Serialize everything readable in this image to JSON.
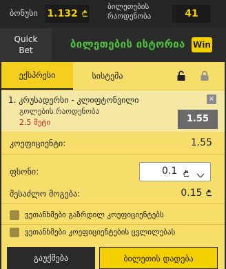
{
  "header": {
    "bonus_label": "ბონუსი",
    "bonus_value": "1.132",
    "tickets_label_line1": "ბილეთების",
    "tickets_label_line2": "რაოდენობა",
    "tickets_value": "41"
  },
  "bar": {
    "quick_line1": "Quick",
    "quick_line2": "Bet",
    "history_title": "ბილეთების ისტორია",
    "win_label": "Win"
  },
  "tabs": [
    {
      "label": "ექსპრესი",
      "active": true
    },
    {
      "label": "სისტემა",
      "active": false
    }
  ],
  "bet": {
    "number": "1.",
    "event": "კრუსადერსი - კლიფტონვილი",
    "market": "გოლების რაოდენობა",
    "selection": "2.5 მეტი",
    "odds": "1.55",
    "close_symbol": "×"
  },
  "summary": {
    "coef_label": "კოეფიციენტი:",
    "coef_value": "1.55",
    "stake_label": "ფსონი:",
    "stake_value": "0.1",
    "payout_label": "შესაძლო მოგება:",
    "payout_value": "0.15"
  },
  "options": [
    {
      "label": "ვეთანხმები გაზრდილ კოეფიციენტებს",
      "checked": false
    },
    {
      "label": "ვეთანხმები კოეფიციენტების ცვლილებას",
      "checked": false
    }
  ],
  "actions": {
    "clear_label": "გაუქმება",
    "place_label": "ბილეთის დადება"
  },
  "colors": {
    "accent": "#f5d000",
    "panel": "#f7dd6a",
    "history_green": "#4ec23d",
    "selection_red": "#d11a1a"
  }
}
